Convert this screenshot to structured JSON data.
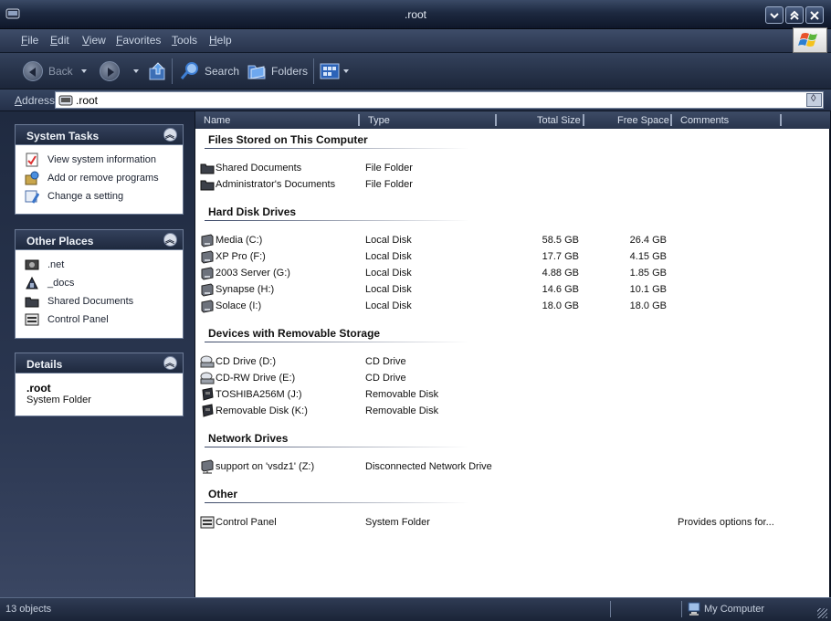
{
  "window": {
    "title": ".root"
  },
  "menu": [
    "File",
    "Edit",
    "View",
    "Favorites",
    "Tools",
    "Help"
  ],
  "toolbar": {
    "back_label": "Back",
    "search_label": "Search",
    "folders_label": "Folders"
  },
  "address": {
    "label": "Address",
    "value": ".root"
  },
  "task_pane": {
    "system_tasks": {
      "title": "System Tasks",
      "items": [
        "View system information",
        "Add or remove programs",
        "Change a setting"
      ]
    },
    "other_places": {
      "title": "Other Places",
      "items": [
        ".net",
        "_docs",
        "Shared Documents",
        "Control Panel"
      ]
    },
    "details": {
      "title": "Details",
      "name": ".root",
      "type": "System Folder"
    }
  },
  "columns": [
    "Name",
    "Type",
    "Total Size",
    "Free Space",
    "Comments"
  ],
  "groups": [
    {
      "title": "Files Stored on This Computer",
      "rows": [
        {
          "name": "Shared Documents",
          "type": "File Folder",
          "total": "",
          "free": "",
          "comment": "",
          "icon": "folder-icon"
        },
        {
          "name": "Administrator's Documents",
          "type": "File Folder",
          "total": "",
          "free": "",
          "comment": "",
          "icon": "folder-icon"
        }
      ]
    },
    {
      "title": "Hard Disk Drives",
      "rows": [
        {
          "name": "Media (C:)",
          "type": "Local Disk",
          "total": "58.5 GB",
          "free": "26.4 GB",
          "comment": "",
          "icon": "hard-disk-icon"
        },
        {
          "name": "XP Pro (F:)",
          "type": "Local Disk",
          "total": "17.7 GB",
          "free": "4.15 GB",
          "comment": "",
          "icon": "hard-disk-icon"
        },
        {
          "name": "2003 Server (G:)",
          "type": "Local Disk",
          "total": "4.88 GB",
          "free": "1.85 GB",
          "comment": "",
          "icon": "hard-disk-icon"
        },
        {
          "name": "Synapse (H:)",
          "type": "Local Disk",
          "total": "14.6 GB",
          "free": "10.1 GB",
          "comment": "",
          "icon": "hard-disk-icon"
        },
        {
          "name": "Solace (I:)",
          "type": "Local Disk",
          "total": "18.0 GB",
          "free": "18.0 GB",
          "comment": "",
          "icon": "hard-disk-icon"
        }
      ]
    },
    {
      "title": "Devices with Removable Storage",
      "rows": [
        {
          "name": "CD Drive (D:)",
          "type": "CD Drive",
          "total": "",
          "free": "",
          "comment": "",
          "icon": "cd-drive-icon"
        },
        {
          "name": "CD-RW Drive (E:)",
          "type": "CD Drive",
          "total": "",
          "free": "",
          "comment": "",
          "icon": "cd-drive-icon"
        },
        {
          "name": "TOSHIBA256M (J:)",
          "type": "Removable Disk",
          "total": "",
          "free": "",
          "comment": "",
          "icon": "removable-disk-icon"
        },
        {
          "name": "Removable Disk (K:)",
          "type": "Removable Disk",
          "total": "",
          "free": "",
          "comment": "",
          "icon": "removable-disk-icon"
        }
      ]
    },
    {
      "title": "Network Drives",
      "rows": [
        {
          "name": "support on 'vsdz1' (Z:)",
          "type": "Disconnected Network Drive",
          "total": "",
          "free": "",
          "comment": "",
          "icon": "network-drive-icon"
        }
      ]
    },
    {
      "title": "Other",
      "rows": [
        {
          "name": "Control Panel",
          "type": "System Folder",
          "total": "",
          "free": "",
          "comment": "Provides options for...",
          "icon": "control-panel-icon"
        }
      ]
    }
  ],
  "status": {
    "objects": "13 objects",
    "location": "My Computer"
  }
}
